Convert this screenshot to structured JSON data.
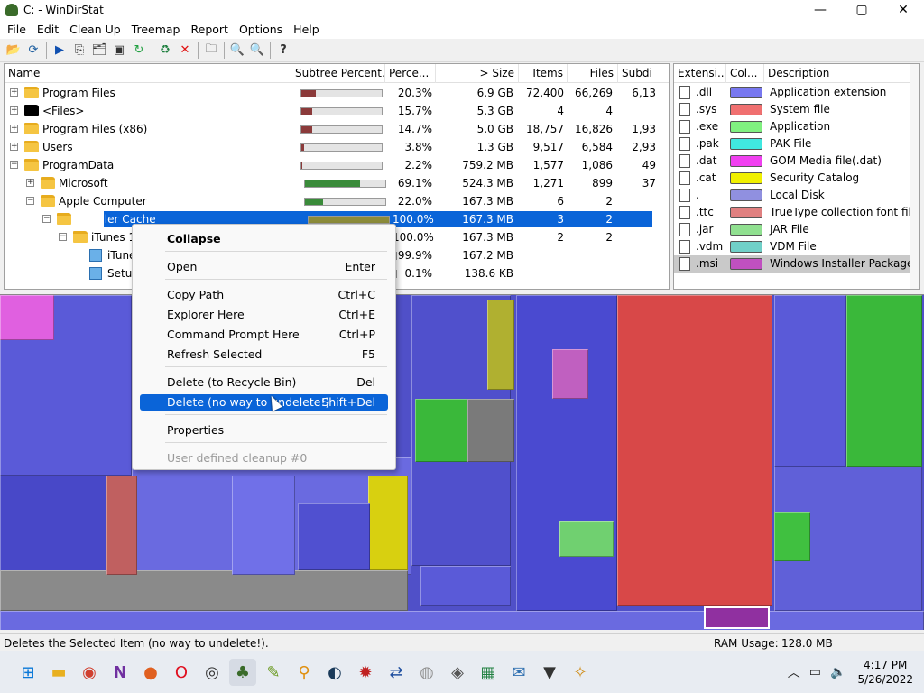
{
  "window": {
    "title": "C: - WinDirStat",
    "min": "—",
    "max": "▢",
    "close": "✕"
  },
  "menu": [
    "File",
    "Edit",
    "Clean Up",
    "Treemap",
    "Report",
    "Options",
    "Help"
  ],
  "toolbar_icons": [
    "open-icon",
    "refresh-all-icon",
    "play-icon",
    "copy-path-icon",
    "explorer-icon",
    "cmd-icon",
    "refresh-icon",
    "recycle-icon",
    "delete-icon",
    "new-folder-icon",
    "zoom-in-icon",
    "zoom-out-icon",
    "help-icon"
  ],
  "tree": {
    "headers": [
      "Name",
      "Subtree Percent...",
      "Perce...",
      "> Size",
      "Items",
      "Files",
      "Subdi"
    ],
    "rows": [
      {
        "name": "Program Files",
        "pct": "20.3%",
        "size": "6.9 GB",
        "items": "72,400",
        "files": "66,269",
        "subdirs": "6,13",
        "fill": 0.18
      },
      {
        "name": "<Files>",
        "pct": "15.7%",
        "size": "5.3 GB",
        "items": "4",
        "files": "4",
        "subdirs": "",
        "fill": 0.14
      },
      {
        "name": "Program Files (x86)",
        "pct": "14.7%",
        "size": "5.0 GB",
        "items": "18,757",
        "files": "16,826",
        "subdirs": "1,93",
        "fill": 0.13
      },
      {
        "name": "Users",
        "pct": "3.8%",
        "size": "1.3 GB",
        "items": "9,517",
        "files": "6,584",
        "subdirs": "2,93",
        "fill": 0.03
      },
      {
        "name": "ProgramData",
        "pct": "2.2%",
        "size": "759.2 MB",
        "items": "1,577",
        "files": "1,086",
        "subdirs": "49",
        "fill": 0.01
      },
      {
        "name": "Microsoft",
        "pct": "69.1%",
        "size": "524.3 MB",
        "items": "1,271",
        "files": "899",
        "subdirs": "37",
        "fill": 0.69
      },
      {
        "name": "Apple Computer",
        "pct": "22.0%",
        "size": "167.3 MB",
        "items": "6",
        "files": "2",
        "subdirs": "",
        "fill": 0.22
      },
      {
        "name": "Installer Cache",
        "pct": "100.0%",
        "size": "167.3 MB",
        "items": "3",
        "files": "2",
        "subdirs": "",
        "fill": 1.0
      },
      {
        "name": "iTunes 12",
        "pct": "100.0%",
        "size": "167.3 MB",
        "items": "2",
        "files": "2",
        "subdirs": "",
        "fill": 1.0
      },
      {
        "name": "iTunes",
        "pct": "99.9%",
        "size": "167.2 MB",
        "items": "",
        "files": "",
        "subdirs": "",
        "fill": 1.0
      },
      {
        "name": "SetupA",
        "pct": "0.1%",
        "size": "138.6 KB",
        "items": "",
        "files": "",
        "subdirs": "",
        "fill": 0.0
      }
    ]
  },
  "extensions": {
    "headers": [
      "Extensi...",
      "Col...",
      "Description"
    ],
    "rows": [
      {
        "ext": ".dll",
        "color": "#7878f0",
        "desc": "Application extension"
      },
      {
        "ext": ".sys",
        "color": "#f07070",
        "desc": "System file"
      },
      {
        "ext": ".exe",
        "color": "#80f080",
        "desc": "Application"
      },
      {
        "ext": ".pak",
        "color": "#40e8e0",
        "desc": "PAK File"
      },
      {
        "ext": ".dat",
        "color": "#f040f0",
        "desc": "GOM Media file(.dat)"
      },
      {
        "ext": ".cat",
        "color": "#f0f000",
        "desc": "Security Catalog"
      },
      {
        "ext": ".",
        "color": "#9090e0",
        "desc": "Local Disk"
      },
      {
        "ext": ".ttc",
        "color": "#e08080",
        "desc": "TrueType collection font file"
      },
      {
        "ext": ".jar",
        "color": "#90e090",
        "desc": "JAR File"
      },
      {
        "ext": ".vdm",
        "color": "#70d0c8",
        "desc": "VDM File"
      },
      {
        "ext": ".msi",
        "color": "#c050c0",
        "desc": "Windows Installer Package"
      }
    ]
  },
  "context_menu": {
    "items": [
      {
        "label": "Collapse",
        "shortcut": "",
        "bold": true
      },
      {
        "label": "Open",
        "shortcut": "Enter"
      },
      {
        "label": "Copy Path",
        "shortcut": "Ctrl+C"
      },
      {
        "label": "Explorer Here",
        "shortcut": "Ctrl+E"
      },
      {
        "label": "Command Prompt Here",
        "shortcut": "Ctrl+P"
      },
      {
        "label": "Refresh Selected",
        "shortcut": "F5"
      },
      {
        "label": "Delete (to Recycle Bin)",
        "shortcut": "Del"
      },
      {
        "label": "Delete (no way to undelete!)",
        "shortcut": "Shift+Del",
        "highlighted": true
      },
      {
        "label": "Properties",
        "shortcut": ""
      },
      {
        "label": "User defined cleanup #0",
        "shortcut": "",
        "disabled": true
      }
    ]
  },
  "status": {
    "message": "Deletes the Selected Item (no way to undelete!).",
    "ram_label": "RAM Usage:",
    "ram_value": "128.0 MB"
  },
  "taskbar": {
    "apps": [
      "start-icon",
      "file-explorer-icon",
      "chrome-icon",
      "notion-icon",
      "firefox-icon",
      "opera-icon",
      "obs-icon",
      "windirstat-icon",
      "notepad-icon",
      "search-app-icon",
      "steam-icon",
      "app-icon-1",
      "network-app-icon",
      "disk-app-icon",
      "game-app-icon",
      "spreadsheet-icon",
      "mail-app-icon",
      "wolf-icon",
      "tool-icon"
    ],
    "time": "4:17 PM",
    "date": "5/26/2022"
  },
  "colors": {
    "selection": "#0a64d8",
    "bar_red": "#8b3a3a",
    "bar_green": "#3a8b3a",
    "bar_olive": "#8b8b3a"
  }
}
